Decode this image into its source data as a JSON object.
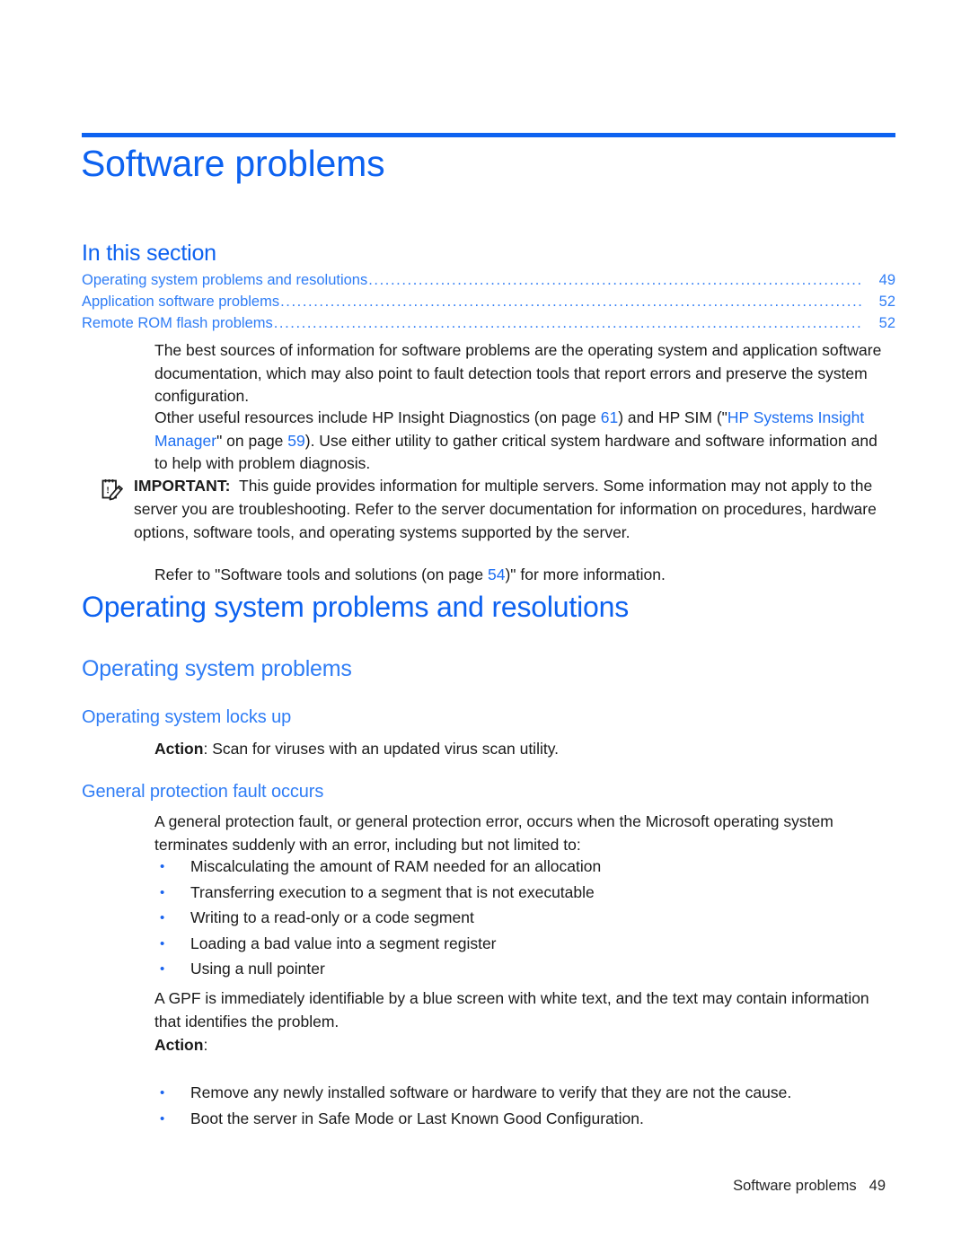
{
  "document": {
    "chapter_title": "Software problems",
    "accent_color": "#0d62f0",
    "link_color": "#2f7df6"
  },
  "in_this_section": {
    "heading": "In this section",
    "dots": "..........................................................................................................................................................................",
    "entries": [
      {
        "label": "Operating system problems and resolutions",
        "page": "49"
      },
      {
        "label": "Application software problems",
        "page": "52"
      },
      {
        "label": "Remote ROM flash problems",
        "page": "52"
      }
    ]
  },
  "intro": {
    "paragraph_1": "The best sources of information for software problems are the operating system and application software documentation, which may also point to fault detection tools that report errors and preserve the system configuration.",
    "paragraph_2_part1": "Other useful resources include HP Insight Diagnostics (on page ",
    "paragraph_2_link1": "61",
    "paragraph_2_part2": ") and HP SIM (\"",
    "paragraph_2_link2": "HP Systems Insight Manager",
    "paragraph_2_part3": "\" on page ",
    "paragraph_2_link3": "59",
    "paragraph_2_part4": "). Use either utility to gather critical system hardware and software information and to help with problem diagnosis."
  },
  "important_note": {
    "icon": "note-pencil-icon",
    "label": "IMPORTANT:",
    "text": "This guide provides information for multiple servers. Some information may not apply to the server you are troubleshooting. Refer to the server documentation for information on procedures, hardware options, software tools, and operating systems supported by the server.",
    "refer_part1": "Refer to \"Software tools and solutions (on page ",
    "refer_link": "54",
    "refer_part2": ")\" for more information."
  },
  "sections": {
    "h1": "Operating system problems and resolutions",
    "h2": "Operating system problems",
    "h3_locks_up": "Operating system locks up",
    "h3_gpf": "General protection fault occurs"
  },
  "locks_up": {
    "action_label": "Action",
    "action_sep": ": ",
    "action_text": "Scan for viruses with an updated virus scan utility."
  },
  "gpf": {
    "paragraph_1": "A general protection fault, or general protection error, occurs when the Microsoft operating system terminates suddenly with an error, including but not limited to:",
    "bullets": [
      "Miscalculating the amount of RAM needed for an allocation",
      "Transferring execution to a segment that is not executable",
      "Writing to a read-only or a code segment",
      "Loading a bad value into a segment register",
      "Using a null pointer"
    ],
    "paragraph_2": "A GPF is immediately identifiable by a blue screen with white text, and the text may contain information that identifies the problem.",
    "action_label": "Action",
    "action_sep": ":",
    "action_bullets": [
      "Remove any newly installed software or hardware to verify that they are not the cause.",
      "Boot the server in Safe Mode or Last Known Good Configuration."
    ]
  },
  "footer": {
    "title": "Software problems",
    "page_number": "49"
  },
  "glyphs": {
    "bullet": "•"
  }
}
